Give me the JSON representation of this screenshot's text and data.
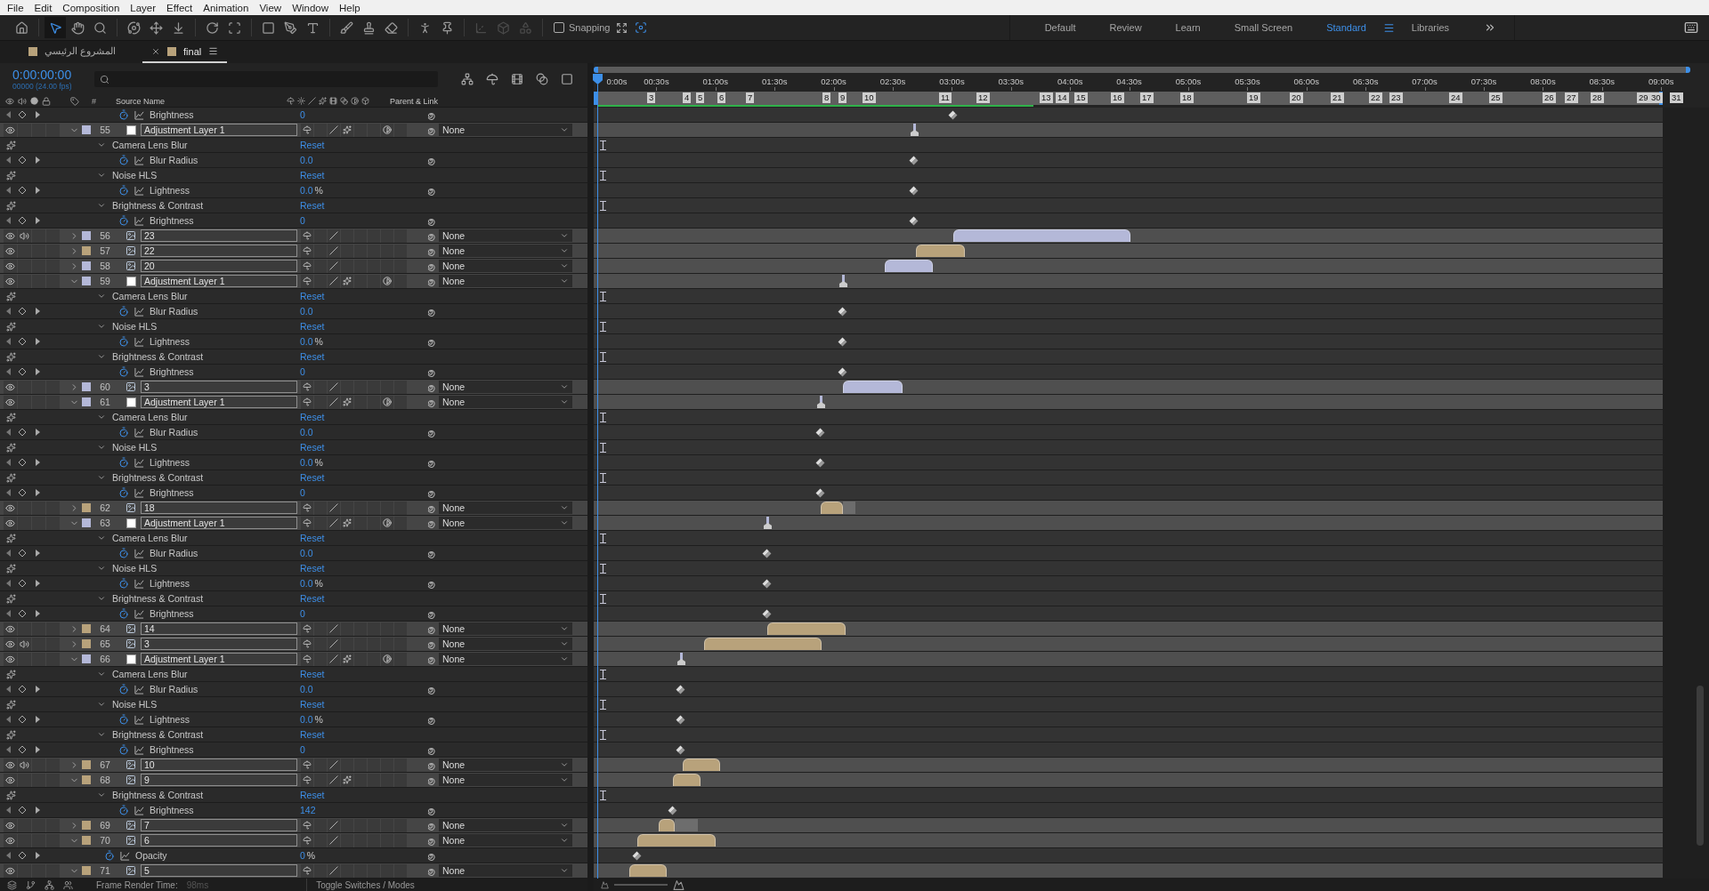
{
  "menu": [
    "File",
    "Edit",
    "Composition",
    "Layer",
    "Effect",
    "Animation",
    "View",
    "Window",
    "Help"
  ],
  "tools": [
    {
      "selected": false,
      "disabled": false
    },
    {
      "selected": true,
      "disabled": false
    },
    {
      "selected": false,
      "disabled": false
    },
    {
      "selected": false,
      "disabled": false
    },
    {
      "selected": false,
      "disabled": false
    },
    {
      "selected": false,
      "disabled": false
    },
    {
      "selected": false,
      "disabled": false
    },
    {
      "selected": false,
      "disabled": false
    },
    {
      "selected": false,
      "disabled": false
    },
    {
      "selected": false,
      "disabled": false
    },
    {
      "selected": false,
      "disabled": false
    },
    {
      "selected": false,
      "disabled": false
    },
    {
      "selected": false,
      "disabled": false
    },
    {
      "selected": false,
      "disabled": false
    },
    {
      "selected": false,
      "disabled": false
    },
    {
      "selected": false,
      "disabled": false
    },
    {
      "selected": false,
      "disabled": false
    },
    {
      "selected": false,
      "disabled": true
    },
    {
      "selected": false,
      "disabled": true
    },
    {
      "selected": false,
      "disabled": true
    }
  ],
  "snapping": {
    "label": "Snapping",
    "checked": false
  },
  "workspaces": [
    {
      "label": "Default",
      "selected": false
    },
    {
      "label": "Review",
      "selected": false
    },
    {
      "label": "Learn",
      "selected": false
    },
    {
      "label": "Small Screen",
      "selected": false
    },
    {
      "label": "Standard",
      "selected": true
    },
    {
      "label": "Libraries",
      "selected": false
    }
  ],
  "tabs": [
    {
      "label": "المشروع الرئيسي",
      "selected": false
    },
    {
      "label": "final",
      "selected": true
    }
  ],
  "timecode": "0:00:00:00",
  "frame_info": "00000 (24.00 fps)",
  "columns": {
    "number": "#",
    "source_name": "Source Name",
    "parent": "Parent & Link"
  },
  "ruler": [
    "0:00s",
    "00:30s",
    "01:00s",
    "01:30s",
    "02:00s",
    "02:30s",
    "03:00s",
    "03:30s",
    "04:00s",
    "04:30s",
    "05:00s",
    "05:30s",
    "06:00s",
    "06:30s",
    "07:00s",
    "07:30s",
    "08:00s",
    "08:30s",
    "09:00s"
  ],
  "markers": [
    "3",
    "4",
    "5",
    "6",
    "7",
    "8",
    "9",
    "10",
    "11",
    "12",
    "13",
    "14",
    "15",
    "16",
    "17",
    "18",
    "19",
    "20",
    "21",
    "22",
    "23",
    "24",
    "25",
    "26",
    "27",
    "28",
    "29",
    "30",
    "31"
  ],
  "rows": [
    {
      "kind": "property",
      "name": "Brightness",
      "value": "0",
      "animated": true
    },
    {
      "kind": "layer",
      "number": "55",
      "name": "Adjustment Layer 1",
      "solid": true,
      "color": "#b4b8d8",
      "visible": true,
      "audio": false,
      "solo": false,
      "locked": false,
      "expanded": true,
      "shy": false,
      "collapse": false,
      "draft": false,
      "fx": true,
      "frame_blend": false,
      "motion_blur": false,
      "adjustment": true,
      "three_d": false,
      "parent": "None",
      "children": [
        {
          "kind": "effect",
          "name": "Camera Lens Blur",
          "reset": "Reset",
          "expanded": true,
          "children": [
            {
              "kind": "property",
              "name": "Blur Radius",
              "value": "0.0",
              "animated": true
            }
          ]
        },
        {
          "kind": "effect",
          "name": "Noise HLS",
          "reset": "Reset",
          "expanded": true,
          "children": [
            {
              "kind": "property",
              "name": "Lightness",
              "value": "0.0",
              "unit": "%",
              "animated": true
            }
          ]
        },
        {
          "kind": "effect",
          "name": "Brightness & Contrast",
          "reset": "Reset",
          "expanded": true,
          "children": [
            {
              "kind": "property",
              "name": "Brightness",
              "value": "0",
              "animated": true
            }
          ]
        }
      ]
    },
    {
      "kind": "layer",
      "number": "56",
      "name": "23",
      "solid": false,
      "color": "#b4b8d8",
      "visible": true,
      "audio": true,
      "solo": false,
      "locked": false,
      "expanded": false,
      "shy": false,
      "collapse": false,
      "draft": false,
      "fx": false,
      "frame_blend": false,
      "motion_blur": false,
      "adjustment": false,
      "three_d": false,
      "parent": "None"
    },
    {
      "kind": "layer",
      "number": "57",
      "name": "22",
      "solid": false,
      "color": "#b8a27b",
      "visible": true,
      "audio": false,
      "solo": false,
      "locked": false,
      "expanded": false,
      "shy": false,
      "collapse": false,
      "draft": false,
      "fx": false,
      "frame_blend": false,
      "motion_blur": false,
      "adjustment": false,
      "three_d": false,
      "parent": "None"
    },
    {
      "kind": "layer",
      "number": "58",
      "name": "20",
      "solid": false,
      "color": "#b4b8d8",
      "visible": true,
      "audio": false,
      "solo": false,
      "locked": false,
      "expanded": false,
      "shy": false,
      "collapse": false,
      "draft": false,
      "fx": false,
      "frame_blend": false,
      "motion_blur": false,
      "adjustment": false,
      "three_d": false,
      "parent": "None"
    },
    {
      "kind": "layer",
      "number": "59",
      "name": "Adjustment Layer 1",
      "solid": true,
      "color": "#b4b8d8",
      "visible": true,
      "audio": false,
      "solo": false,
      "locked": false,
      "expanded": true,
      "shy": false,
      "collapse": false,
      "draft": false,
      "fx": true,
      "frame_blend": false,
      "motion_blur": false,
      "adjustment": true,
      "three_d": false,
      "parent": "None",
      "children": [
        {
          "kind": "effect",
          "name": "Camera Lens Blur",
          "reset": "Reset",
          "expanded": true,
          "children": [
            {
              "kind": "property",
              "name": "Blur Radius",
              "value": "0.0",
              "animated": true
            }
          ]
        },
        {
          "kind": "effect",
          "name": "Noise HLS",
          "reset": "Reset",
          "expanded": true,
          "children": [
            {
              "kind": "property",
              "name": "Lightness",
              "value": "0.0",
              "unit": "%",
              "animated": true
            }
          ]
        },
        {
          "kind": "effect",
          "name": "Brightness & Contrast",
          "reset": "Reset",
          "expanded": true,
          "children": [
            {
              "kind": "property",
              "name": "Brightness",
              "value": "0",
              "animated": true
            }
          ]
        }
      ]
    },
    {
      "kind": "layer",
      "number": "60",
      "name": "3",
      "solid": false,
      "color": "#b4b8d8",
      "visible": true,
      "audio": false,
      "solo": false,
      "locked": false,
      "expanded": false,
      "shy": false,
      "collapse": false,
      "draft": false,
      "fx": false,
      "frame_blend": false,
      "motion_blur": false,
      "adjustment": false,
      "three_d": false,
      "parent": "None"
    },
    {
      "kind": "layer",
      "number": "61",
      "name": "Adjustment Layer 1",
      "solid": true,
      "color": "#b4b8d8",
      "visible": true,
      "audio": false,
      "solo": false,
      "locked": false,
      "expanded": true,
      "shy": false,
      "collapse": false,
      "draft": false,
      "fx": true,
      "frame_blend": false,
      "motion_blur": false,
      "adjustment": true,
      "three_d": false,
      "parent": "None",
      "children": [
        {
          "kind": "effect",
          "name": "Camera Lens Blur",
          "reset": "Reset",
          "expanded": true,
          "children": [
            {
              "kind": "property",
              "name": "Blur Radius",
              "value": "0.0",
              "animated": true
            }
          ]
        },
        {
          "kind": "effect",
          "name": "Noise HLS",
          "reset": "Reset",
          "expanded": true,
          "children": [
            {
              "kind": "property",
              "name": "Lightness",
              "value": "0.0",
              "unit": "%",
              "animated": true
            }
          ]
        },
        {
          "kind": "effect",
          "name": "Brightness & Contrast",
          "reset": "Reset",
          "expanded": true,
          "children": [
            {
              "kind": "property",
              "name": "Brightness",
              "value": "0",
              "animated": true
            }
          ]
        }
      ]
    },
    {
      "kind": "layer",
      "number": "62",
      "name": "18",
      "solid": false,
      "color": "#b8a27b",
      "visible": true,
      "audio": false,
      "solo": false,
      "locked": false,
      "expanded": false,
      "shy": false,
      "collapse": false,
      "draft": false,
      "fx": false,
      "frame_blend": false,
      "motion_blur": false,
      "adjustment": false,
      "three_d": false,
      "parent": "None"
    },
    {
      "kind": "layer",
      "number": "63",
      "name": "Adjustment Layer 1",
      "solid": true,
      "color": "#b4b8d8",
      "visible": true,
      "audio": false,
      "solo": false,
      "locked": false,
      "expanded": true,
      "shy": false,
      "collapse": false,
      "draft": false,
      "fx": true,
      "frame_blend": false,
      "motion_blur": false,
      "adjustment": true,
      "three_d": false,
      "parent": "None",
      "children": [
        {
          "kind": "effect",
          "name": "Camera Lens Blur",
          "reset": "Reset",
          "expanded": true,
          "children": [
            {
              "kind": "property",
              "name": "Blur Radius",
              "value": "0.0",
              "animated": true
            }
          ]
        },
        {
          "kind": "effect",
          "name": "Noise HLS",
          "reset": "Reset",
          "expanded": true,
          "children": [
            {
              "kind": "property",
              "name": "Lightness",
              "value": "0.0",
              "unit": "%",
              "animated": true
            }
          ]
        },
        {
          "kind": "effect",
          "name": "Brightness & Contrast",
          "reset": "Reset",
          "expanded": true,
          "children": [
            {
              "kind": "property",
              "name": "Brightness",
              "value": "0",
              "animated": true
            }
          ]
        }
      ]
    },
    {
      "kind": "layer",
      "number": "64",
      "name": "14",
      "solid": false,
      "color": "#b8a27b",
      "visible": true,
      "audio": false,
      "solo": false,
      "locked": false,
      "expanded": false,
      "shy": false,
      "collapse": false,
      "draft": false,
      "fx": false,
      "frame_blend": false,
      "motion_blur": false,
      "adjustment": false,
      "three_d": false,
      "parent": "None"
    },
    {
      "kind": "layer",
      "number": "65",
      "name": "3",
      "solid": false,
      "color": "#b8a27b",
      "visible": true,
      "audio": true,
      "solo": false,
      "locked": false,
      "expanded": false,
      "shy": false,
      "collapse": false,
      "draft": false,
      "fx": false,
      "frame_blend": false,
      "motion_blur": false,
      "adjustment": false,
      "three_d": false,
      "parent": "None"
    },
    {
      "kind": "layer",
      "number": "66",
      "name": "Adjustment Layer 1",
      "solid": true,
      "color": "#b4b8d8",
      "visible": true,
      "audio": false,
      "solo": false,
      "locked": false,
      "expanded": true,
      "shy": false,
      "collapse": false,
      "draft": false,
      "fx": true,
      "frame_blend": false,
      "motion_blur": false,
      "adjustment": true,
      "three_d": false,
      "parent": "None",
      "children": [
        {
          "kind": "effect",
          "name": "Camera Lens Blur",
          "reset": "Reset",
          "expanded": true,
          "children": [
            {
              "kind": "property",
              "name": "Blur Radius",
              "value": "0.0",
              "animated": true
            }
          ]
        },
        {
          "kind": "effect",
          "name": "Noise HLS",
          "reset": "Reset",
          "expanded": true,
          "children": [
            {
              "kind": "property",
              "name": "Lightness",
              "value": "0.0",
              "unit": "%",
              "animated": true
            }
          ]
        },
        {
          "kind": "effect",
          "name": "Brightness & Contrast",
          "reset": "Reset",
          "expanded": true,
          "children": [
            {
              "kind": "property",
              "name": "Brightness",
              "value": "0",
              "animated": true
            }
          ]
        }
      ]
    },
    {
      "kind": "layer",
      "number": "67",
      "name": "10",
      "solid": false,
      "color": "#b8a27b",
      "visible": true,
      "audio": true,
      "solo": false,
      "locked": false,
      "expanded": false,
      "shy": false,
      "collapse": false,
      "draft": false,
      "fx": false,
      "frame_blend": false,
      "motion_blur": false,
      "adjustment": false,
      "three_d": false,
      "parent": "None"
    },
    {
      "kind": "layer",
      "number": "68",
      "name": "9",
      "solid": false,
      "color": "#b8a27b",
      "visible": true,
      "audio": false,
      "solo": false,
      "locked": false,
      "expanded": true,
      "shy": false,
      "collapse": false,
      "draft": false,
      "fx": true,
      "frame_blend": false,
      "motion_blur": false,
      "adjustment": false,
      "three_d": false,
      "parent": "None",
      "children": [
        {
          "kind": "effect",
          "name": "Brightness & Contrast",
          "reset": "Reset",
          "expanded": true,
          "children": [
            {
              "kind": "property",
              "name": "Brightness",
              "value": "142",
              "animated": true
            }
          ]
        }
      ]
    },
    {
      "kind": "layer",
      "number": "69",
      "name": "7",
      "solid": false,
      "color": "#b8a27b",
      "visible": true,
      "audio": false,
      "solo": false,
      "locked": false,
      "expanded": false,
      "shy": false,
      "collapse": false,
      "draft": false,
      "fx": false,
      "frame_blend": false,
      "motion_blur": false,
      "adjustment": false,
      "three_d": false,
      "parent": "None"
    },
    {
      "kind": "layer",
      "number": "70",
      "name": "6",
      "solid": false,
      "color": "#b8a27b",
      "visible": true,
      "audio": false,
      "solo": false,
      "locked": false,
      "expanded": true,
      "shy": false,
      "collapse": false,
      "draft": false,
      "fx": false,
      "frame_blend": false,
      "motion_blur": false,
      "adjustment": false,
      "three_d": false,
      "parent": "None",
      "children": [
        {
          "kind": "property",
          "name": "Opacity",
          "value": "0",
          "unit": "%",
          "animated": true
        }
      ]
    },
    {
      "kind": "layer",
      "number": "71",
      "name": "5",
      "solid": false,
      "color": "#b8a27b",
      "visible": true,
      "audio": false,
      "solo": false,
      "locked": false,
      "expanded": true,
      "shy": false,
      "collapse": false,
      "draft": false,
      "fx": false,
      "frame_blend": false,
      "motion_blur": false,
      "adjustment": false,
      "three_d": false,
      "parent": "None"
    }
  ],
  "footer": {
    "render_label": "Frame Render Time:",
    "render_time": "98ms",
    "toggle": "Toggle Switches / Modes"
  }
}
